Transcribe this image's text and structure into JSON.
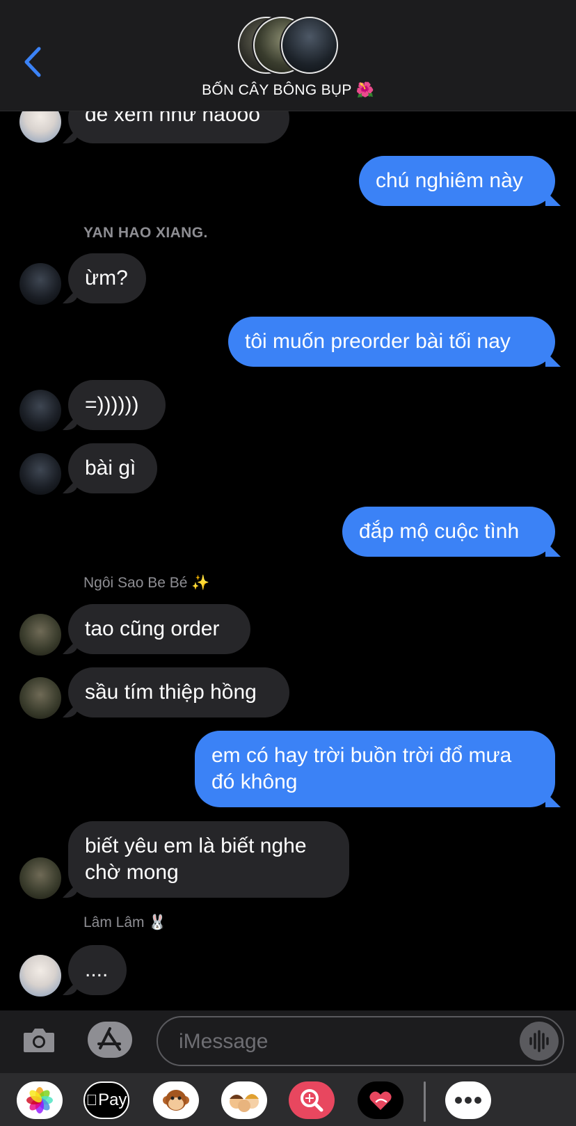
{
  "header": {
    "group_name": "BỐN CÂY BÔNG BỤP 🌺",
    "back_icon": "chevron-left-icon",
    "accent": "#3b82f6"
  },
  "messages": [
    {
      "type": "in",
      "text": "để xem như naooo"
    },
    {
      "type": "out",
      "text": "chú nghiêm này"
    },
    {
      "type": "sender",
      "text": "YAN HAO XIANG."
    },
    {
      "type": "in",
      "text": "ừm?"
    },
    {
      "type": "out",
      "text": "tôi muốn preorder bài tối nay"
    },
    {
      "type": "in",
      "text": "=))))))"
    },
    {
      "type": "in",
      "text": "bài gì"
    },
    {
      "type": "out",
      "text": "đắp mộ cuộc tình"
    },
    {
      "type": "sender",
      "text": "Ngôi Sao Be Bé ✨"
    },
    {
      "type": "in",
      "text": "tao cũng order"
    },
    {
      "type": "in",
      "text": "sầu tím thiệp hồng"
    },
    {
      "type": "out",
      "text": "em có hay trời buồn trời đổ mưa đó không"
    },
    {
      "type": "in",
      "text": "biết yêu em là biết nghe chờ mong"
    },
    {
      "type": "sender",
      "text": "Lâm Lâm 🐰"
    },
    {
      "type": "in",
      "text": "...."
    }
  ],
  "input": {
    "placeholder": "iMessage",
    "camera_icon": "camera-icon",
    "apps_icon": "app-store-icon",
    "audio_icon": "waveform-icon"
  },
  "app_strip": {
    "apple_pay_label": "Pay",
    "items": [
      "photos-icon",
      "apple-pay-icon",
      "monkey-animoji-icon",
      "memoji-icon",
      "image-search-icon",
      "digital-touch-icon",
      "more-icon"
    ]
  },
  "colors": {
    "incoming_bubble": "#262629",
    "outgoing_bubble": "#3b82f6",
    "background": "#000000"
  }
}
